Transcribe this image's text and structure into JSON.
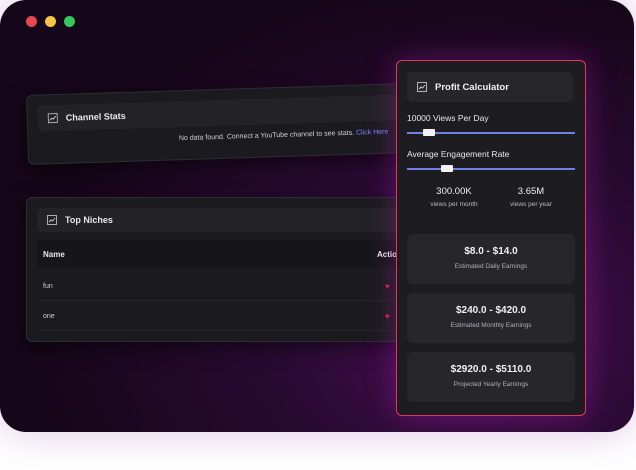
{
  "window": {
    "dots": [
      {
        "name": "close",
        "color": "#e5484d"
      },
      {
        "name": "minimize",
        "color": "#f5c542"
      },
      {
        "name": "maximize",
        "color": "#35c759"
      }
    ]
  },
  "channel_stats": {
    "title": "Channel Stats",
    "message": "No data found. Connect a YouTube channel to see stats.",
    "link": "Click Here"
  },
  "top_niches": {
    "title": "Top Niches",
    "columns": [
      "Name",
      "Action"
    ],
    "rows": [
      {
        "name": "fun"
      },
      {
        "name": "one"
      }
    ]
  },
  "calculator": {
    "title": "Profit Calculator",
    "views_label": "10000 Views Per Day",
    "views_level": 0.1,
    "engagement_label": "Average Engagement Rate",
    "engagement_level": 0.22,
    "monthly_views": "300.00K",
    "monthly_views_label": "views per month",
    "yearly_views": "3.65M",
    "yearly_views_label": "views per year",
    "earnings": [
      {
        "value": "$8.0 - $14.0",
        "label": "Estimated Daily Earnings"
      },
      {
        "value": "$240.0 - $420.0",
        "label": "Estimated Monthly Earnings"
      },
      {
        "value": "$2920.0 - $5110.0",
        "label": "Projected Yearly Earnings"
      }
    ]
  },
  "colors": {
    "accent": "#6e7fe8",
    "link": "#7b86ff",
    "heart": "#e11d48",
    "calc_border": "#e3365f"
  }
}
